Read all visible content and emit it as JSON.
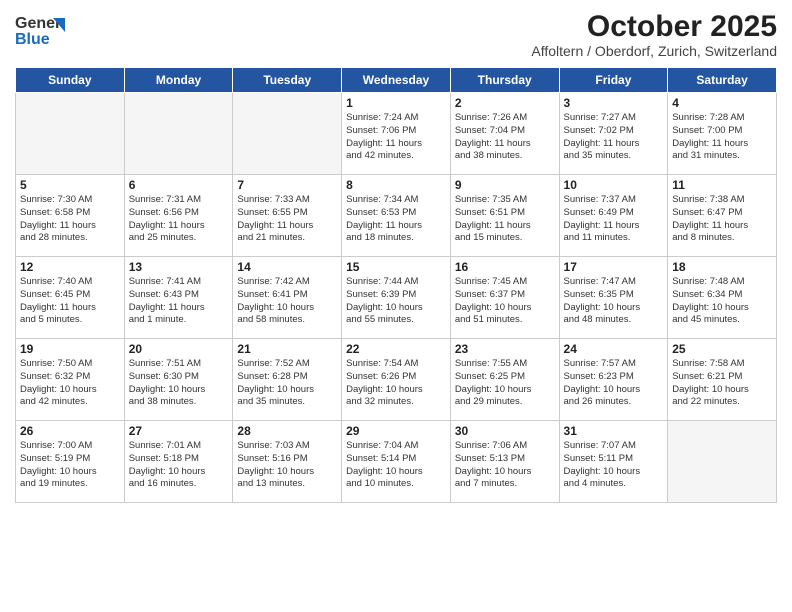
{
  "header": {
    "logo_line1": "General",
    "logo_line2": "Blue",
    "month": "October 2025",
    "location": "Affoltern / Oberdorf, Zurich, Switzerland"
  },
  "days_of_week": [
    "Sunday",
    "Monday",
    "Tuesday",
    "Wednesday",
    "Thursday",
    "Friday",
    "Saturday"
  ],
  "weeks": [
    [
      {
        "day": "",
        "empty": true
      },
      {
        "day": "",
        "empty": true
      },
      {
        "day": "",
        "empty": true
      },
      {
        "day": "1",
        "info": "Sunrise: 7:24 AM\nSunset: 7:06 PM\nDaylight: 11 hours\nand 42 minutes."
      },
      {
        "day": "2",
        "info": "Sunrise: 7:26 AM\nSunset: 7:04 PM\nDaylight: 11 hours\nand 38 minutes."
      },
      {
        "day": "3",
        "info": "Sunrise: 7:27 AM\nSunset: 7:02 PM\nDaylight: 11 hours\nand 35 minutes."
      },
      {
        "day": "4",
        "info": "Sunrise: 7:28 AM\nSunset: 7:00 PM\nDaylight: 11 hours\nand 31 minutes."
      }
    ],
    [
      {
        "day": "5",
        "info": "Sunrise: 7:30 AM\nSunset: 6:58 PM\nDaylight: 11 hours\nand 28 minutes."
      },
      {
        "day": "6",
        "info": "Sunrise: 7:31 AM\nSunset: 6:56 PM\nDaylight: 11 hours\nand 25 minutes."
      },
      {
        "day": "7",
        "info": "Sunrise: 7:33 AM\nSunset: 6:55 PM\nDaylight: 11 hours\nand 21 minutes."
      },
      {
        "day": "8",
        "info": "Sunrise: 7:34 AM\nSunset: 6:53 PM\nDaylight: 11 hours\nand 18 minutes."
      },
      {
        "day": "9",
        "info": "Sunrise: 7:35 AM\nSunset: 6:51 PM\nDaylight: 11 hours\nand 15 minutes."
      },
      {
        "day": "10",
        "info": "Sunrise: 7:37 AM\nSunset: 6:49 PM\nDaylight: 11 hours\nand 11 minutes."
      },
      {
        "day": "11",
        "info": "Sunrise: 7:38 AM\nSunset: 6:47 PM\nDaylight: 11 hours\nand 8 minutes."
      }
    ],
    [
      {
        "day": "12",
        "info": "Sunrise: 7:40 AM\nSunset: 6:45 PM\nDaylight: 11 hours\nand 5 minutes."
      },
      {
        "day": "13",
        "info": "Sunrise: 7:41 AM\nSunset: 6:43 PM\nDaylight: 11 hours\nand 1 minute."
      },
      {
        "day": "14",
        "info": "Sunrise: 7:42 AM\nSunset: 6:41 PM\nDaylight: 10 hours\nand 58 minutes."
      },
      {
        "day": "15",
        "info": "Sunrise: 7:44 AM\nSunset: 6:39 PM\nDaylight: 10 hours\nand 55 minutes."
      },
      {
        "day": "16",
        "info": "Sunrise: 7:45 AM\nSunset: 6:37 PM\nDaylight: 10 hours\nand 51 minutes."
      },
      {
        "day": "17",
        "info": "Sunrise: 7:47 AM\nSunset: 6:35 PM\nDaylight: 10 hours\nand 48 minutes."
      },
      {
        "day": "18",
        "info": "Sunrise: 7:48 AM\nSunset: 6:34 PM\nDaylight: 10 hours\nand 45 minutes."
      }
    ],
    [
      {
        "day": "19",
        "info": "Sunrise: 7:50 AM\nSunset: 6:32 PM\nDaylight: 10 hours\nand 42 minutes."
      },
      {
        "day": "20",
        "info": "Sunrise: 7:51 AM\nSunset: 6:30 PM\nDaylight: 10 hours\nand 38 minutes."
      },
      {
        "day": "21",
        "info": "Sunrise: 7:52 AM\nSunset: 6:28 PM\nDaylight: 10 hours\nand 35 minutes."
      },
      {
        "day": "22",
        "info": "Sunrise: 7:54 AM\nSunset: 6:26 PM\nDaylight: 10 hours\nand 32 minutes."
      },
      {
        "day": "23",
        "info": "Sunrise: 7:55 AM\nSunset: 6:25 PM\nDaylight: 10 hours\nand 29 minutes."
      },
      {
        "day": "24",
        "info": "Sunrise: 7:57 AM\nSunset: 6:23 PM\nDaylight: 10 hours\nand 26 minutes."
      },
      {
        "day": "25",
        "info": "Sunrise: 7:58 AM\nSunset: 6:21 PM\nDaylight: 10 hours\nand 22 minutes."
      }
    ],
    [
      {
        "day": "26",
        "info": "Sunrise: 7:00 AM\nSunset: 5:19 PM\nDaylight: 10 hours\nand 19 minutes."
      },
      {
        "day": "27",
        "info": "Sunrise: 7:01 AM\nSunset: 5:18 PM\nDaylight: 10 hours\nand 16 minutes."
      },
      {
        "day": "28",
        "info": "Sunrise: 7:03 AM\nSunset: 5:16 PM\nDaylight: 10 hours\nand 13 minutes."
      },
      {
        "day": "29",
        "info": "Sunrise: 7:04 AM\nSunset: 5:14 PM\nDaylight: 10 hours\nand 10 minutes."
      },
      {
        "day": "30",
        "info": "Sunrise: 7:06 AM\nSunset: 5:13 PM\nDaylight: 10 hours\nand 7 minutes."
      },
      {
        "day": "31",
        "info": "Sunrise: 7:07 AM\nSunset: 5:11 PM\nDaylight: 10 hours\nand 4 minutes."
      },
      {
        "day": "",
        "empty": true
      }
    ]
  ]
}
